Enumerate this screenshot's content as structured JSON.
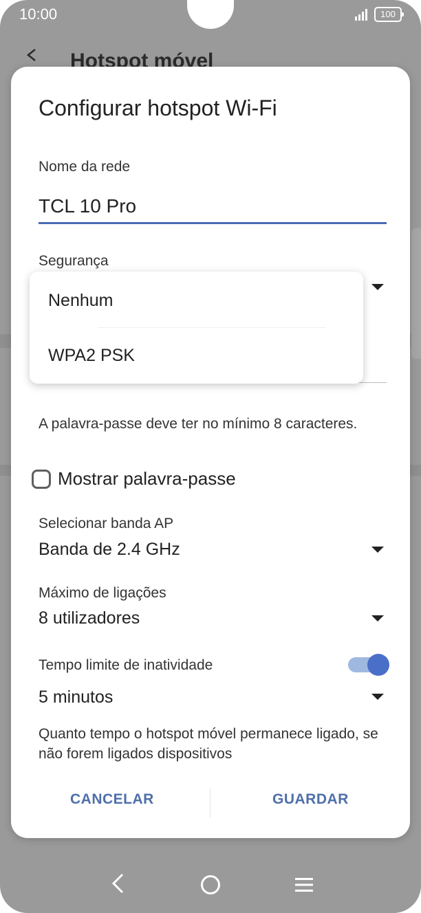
{
  "status_bar": {
    "time": "10:00",
    "battery": "100",
    "icons": [
      "signal-icon",
      "battery-icon"
    ]
  },
  "background_app": {
    "title": "Hotspot móvel",
    "back_icon": "back-arrow-icon"
  },
  "dialog": {
    "title": "Configurar hotspot Wi-Fi",
    "network_name": {
      "label": "Nome da rede",
      "value": "TCL 10 Pro"
    },
    "security": {
      "label": "Segurança",
      "dropdown_open": true,
      "options": [
        "Nenhum",
        "WPA2 PSK"
      ]
    },
    "password_hint": "A palavra-passe deve ter no mínimo 8 caracteres.",
    "show_password": {
      "label": "Mostrar palavra-passe",
      "checked": false
    },
    "ap_band": {
      "label": "Selecionar banda AP",
      "value": "Banda de 2.4 GHz"
    },
    "max_connections": {
      "label": "Máximo de ligações",
      "value": "8 utilizadores"
    },
    "timeout": {
      "label": "Tempo limite de inatividade",
      "enabled": true,
      "value": "5 minutos",
      "description": "Quanto tempo o hotspot móvel permanece ligado, se não forem ligados dispositivos"
    },
    "cancel_label": "CANCELAR",
    "save_label": "GUARDAR"
  },
  "colors": {
    "accent": "#4a6fc8",
    "button_text": "#4e6fab",
    "underline_active": "#4a6bb5",
    "toggle_track": "#9fb8e0",
    "scrim": "#9a9a9a"
  },
  "nav_bar": {
    "icons": [
      "nav-back-icon",
      "nav-home-icon",
      "nav-recents-icon"
    ]
  }
}
